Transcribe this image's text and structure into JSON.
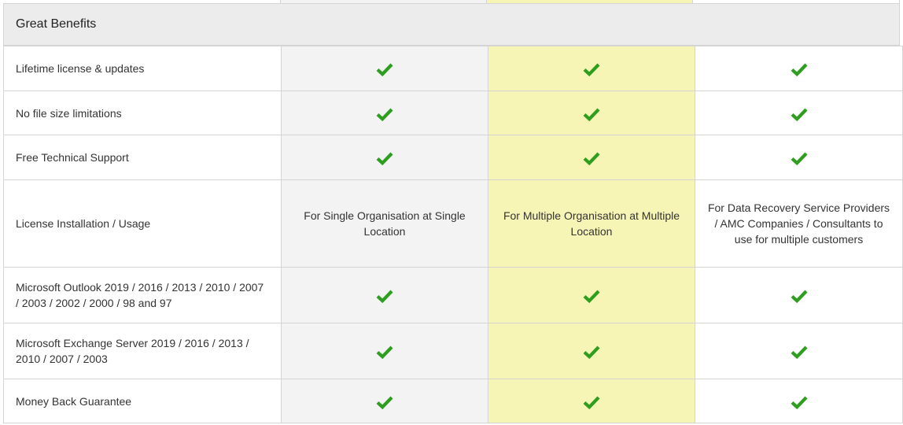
{
  "section": {
    "title": "Great Benefits"
  },
  "rows": [
    {
      "feature": "Lifetime license & updates",
      "kind": "check"
    },
    {
      "feature": "No file size limitations",
      "kind": "check"
    },
    {
      "feature": "Free Technical Support",
      "kind": "check"
    },
    {
      "feature": "License Installation / Usage",
      "kind": "text",
      "values": [
        "For Single Organisation at Single Location",
        "For Multiple Organisation at Multiple Location",
        "For Data Recovery Service Providers / AMC Companies / Consultants to use for multiple customers"
      ]
    },
    {
      "feature": "Microsoft Outlook 2019 / 2016 / 2013 / 2010 / 2007 / 2003 / 2002 / 2000 / 98 and 97",
      "kind": "check"
    },
    {
      "feature": "Microsoft Exchange Server 2019 / 2016 / 2013 / 2010 / 2007 / 2003",
      "kind": "check"
    },
    {
      "feature": "Money Back Guarantee",
      "kind": "check"
    }
  ],
  "colors": {
    "check": "#2e9e1f",
    "highlight_column": "#f7f5b5",
    "shaded_column": "#f3f3f3",
    "header_bg": "#ececec"
  },
  "icons": {
    "included": "checkmark-icon"
  }
}
